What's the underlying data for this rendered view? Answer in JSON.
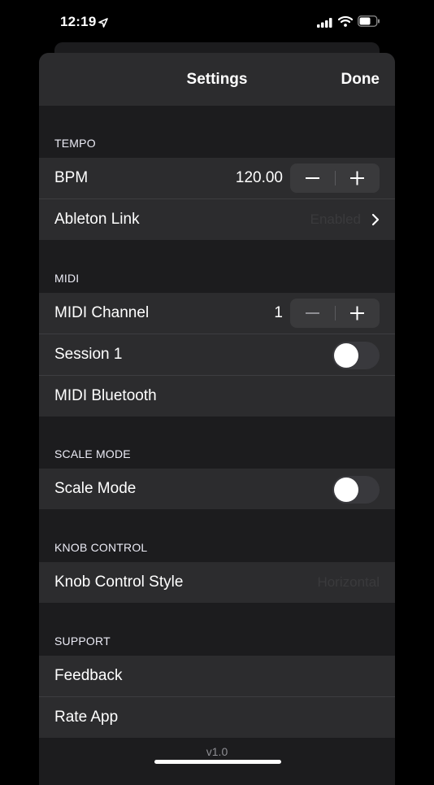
{
  "status_bar": {
    "time": "12:19"
  },
  "nav": {
    "title": "Settings",
    "done_label": "Done"
  },
  "sections": {
    "tempo": {
      "header": "TEMPO",
      "bpm": {
        "label": "BPM",
        "value": "120.00"
      },
      "ableton_link": {
        "label": "Ableton Link",
        "value": "Enabled"
      }
    },
    "midi": {
      "header": "MIDI",
      "channel": {
        "label": "MIDI Channel",
        "value": "1"
      },
      "session": {
        "label": "Session 1",
        "on": false
      },
      "bluetooth": {
        "label": "MIDI Bluetooth"
      }
    },
    "scale_mode": {
      "header": "SCALE MODE",
      "toggle": {
        "label": "Scale Mode",
        "on": false
      }
    },
    "knob_control": {
      "header": "KNOB CONTROL",
      "style": {
        "label": "Knob Control Style",
        "value": "Horizontal"
      }
    },
    "support": {
      "header": "SUPPORT",
      "feedback": {
        "label": "Feedback"
      },
      "rate": {
        "label": "Rate App"
      }
    }
  },
  "footer": {
    "version": "v1.0"
  },
  "icons": {
    "location": "location-arrow-icon",
    "signal": "cellular-signal-icon",
    "wifi": "wifi-icon",
    "battery": "battery-icon",
    "minus": "minus-icon",
    "plus": "plus-icon",
    "chevron": "chevron-right-icon"
  },
  "colors": {
    "background": "#000000",
    "sheet": "#1c1c1e",
    "cell": "#2c2c2e",
    "separator": "#3d3d40",
    "toggle_off": "#39393d"
  }
}
